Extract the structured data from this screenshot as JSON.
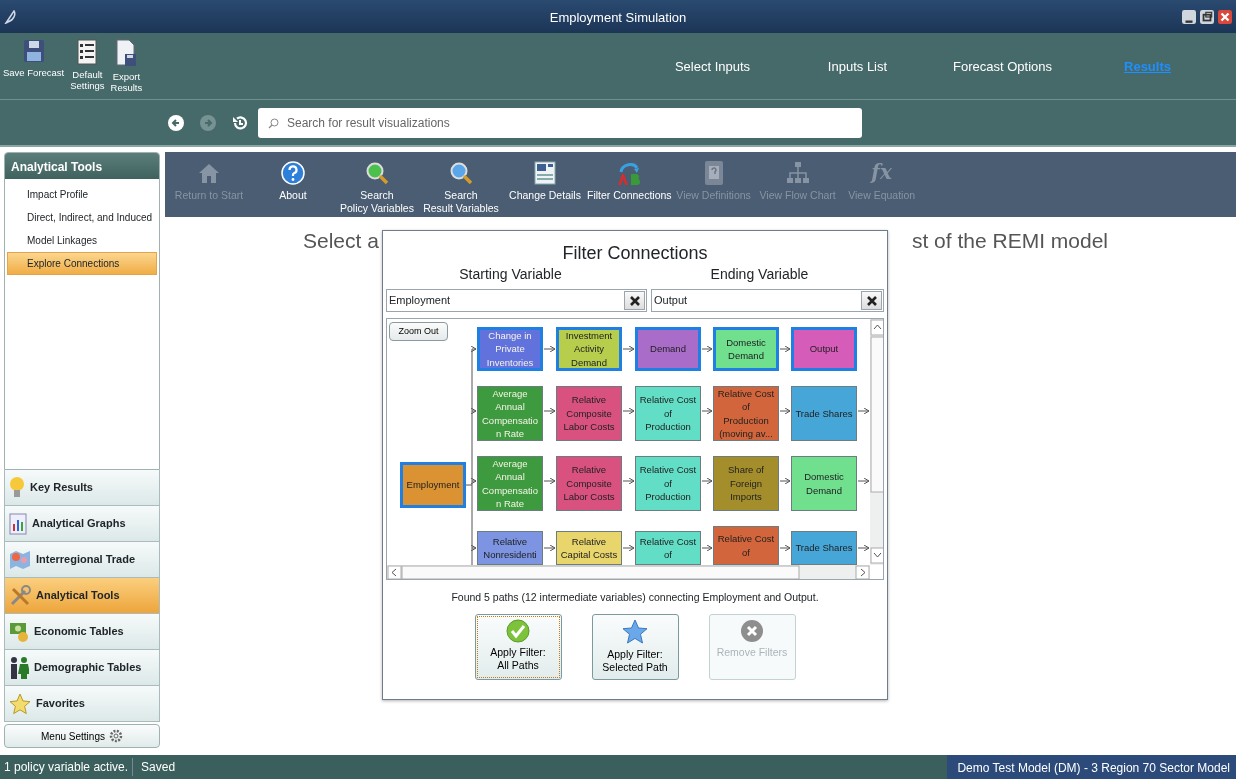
{
  "window": {
    "title": "Employment Simulation"
  },
  "ribbon": {
    "buttons": [
      "Save Forecast",
      "Default\nSettings",
      "Export\nResults"
    ],
    "nav": [
      {
        "label": "Select Inputs",
        "selected": false
      },
      {
        "label": "Inputs List",
        "selected": false
      },
      {
        "label": "Forecast Options",
        "selected": false
      },
      {
        "label": "Results",
        "selected": true
      }
    ]
  },
  "history": [
    {
      "disabled": false
    },
    {
      "disabled": true
    },
    {
      "disabled": false
    }
  ],
  "search": {
    "placeholder": "Search for result visualizations"
  },
  "sidebar": {
    "panel_title": "Analytical Tools",
    "items": [
      {
        "label": "Impact Profile",
        "selected": false
      },
      {
        "label": "Direct, Indirect, and Induced",
        "selected": false
      },
      {
        "label": "Model Linkages",
        "selected": false
      },
      {
        "label": "Explore Connections",
        "selected": true
      }
    ],
    "sections": [
      {
        "label": "Key Results",
        "selected": false
      },
      {
        "label": "Analytical Graphs",
        "selected": false
      },
      {
        "label": "Interregional Trade",
        "selected": false
      },
      {
        "label": "Analytical Tools",
        "selected": true
      },
      {
        "label": "Economic Tables",
        "selected": false
      },
      {
        "label": "Demographic Tables",
        "selected": false
      },
      {
        "label": "Favorites",
        "selected": false
      }
    ],
    "settings_button": "Menu Settings"
  },
  "toolbar": [
    {
      "label": "Return to Start",
      "disabled": true
    },
    {
      "label": "About",
      "disabled": false
    },
    {
      "label": "Search\nPolicy Variables",
      "disabled": false
    },
    {
      "label": "Search\nResult Variables",
      "disabled": false
    },
    {
      "label": "Change Details",
      "disabled": false
    },
    {
      "label": "Filter Connections",
      "disabled": false
    },
    {
      "label": "View Definitions",
      "disabled": true
    },
    {
      "label": "View Flow Chart",
      "disabled": true
    },
    {
      "label": "View Equation",
      "glyph": "fx",
      "disabled": true
    }
  ],
  "headline": {
    "before": "Select a",
    "after": "st of the REMI model"
  },
  "dialog": {
    "title": "Filter Connections",
    "start": {
      "label": "Starting Variable",
      "value": "Employment"
    },
    "end": {
      "label": "Ending Variable",
      "value": "Output"
    },
    "zoom_button": "Zoom Out",
    "source": {
      "text": "Employment",
      "color": "#db9232",
      "highlighted": true
    },
    "paths": [
      [
        {
          "text": "Change in\nPrivate\nInventories",
          "color": "#6272dc",
          "highlighted": true
        },
        {
          "text": "Investment\nActivity\nDemand",
          "color": "#b7cd4c",
          "highlighted": true
        },
        {
          "text": "Demand",
          "color": "#a96cc9",
          "highlighted": true
        },
        {
          "text": "Domestic\nDemand",
          "color": "#70e08f",
          "highlighted": true
        },
        {
          "text": "Output",
          "color": "#d65cb9",
          "highlighted": true
        }
      ],
      [
        {
          "text": "Average\nAnnual\nCompensatio\nn Rate",
          "color": "#3e9a3e",
          "highlighted": false
        },
        {
          "text": "Relative\nComposite\nLabor Costs",
          "color": "#d9527f",
          "highlighted": false
        },
        {
          "text": "Relative Cost\nof\nProduction",
          "color": "#62ddc6",
          "highlighted": false
        },
        {
          "text": "Relative Cost\nof\nProduction\n(moving av...",
          "color": "#d2653b",
          "highlighted": false
        },
        {
          "text": "Trade Shares",
          "color": "#46a6d8",
          "highlighted": false
        }
      ],
      [
        {
          "text": "Average\nAnnual\nCompensatio\nn Rate",
          "color": "#3e9a3e",
          "highlighted": false
        },
        {
          "text": "Relative\nComposite\nLabor Costs",
          "color": "#d9527f",
          "highlighted": false
        },
        {
          "text": "Relative Cost\nof\nProduction",
          "color": "#62ddc6",
          "highlighted": false
        },
        {
          "text": "Share of\nForeign\nImports",
          "color": "#a48e2c",
          "highlighted": false
        },
        {
          "text": "Domestic\nDemand",
          "color": "#70e08f",
          "highlighted": false
        }
      ],
      [
        {
          "text": "Relative\nNonresidenti",
          "color": "#7c94e1",
          "highlighted": false
        },
        {
          "text": "Relative\nCapital Costs",
          "color": "#e8d66c",
          "highlighted": false
        },
        {
          "text": "Relative Cost\nof",
          "color": "#62ddc6",
          "highlighted": false
        },
        {
          "text": "Relative Cost\nof",
          "color": "#d2653b",
          "highlighted": false
        },
        {
          "text": "Trade Shares",
          "color": "#46a6d8",
          "highlighted": false
        }
      ]
    ],
    "summary": "Found 5 paths (12 intermediate variables) connecting Employment and Output.",
    "buttons": [
      {
        "label": "Apply Filter:\nAll Paths",
        "disabled": false,
        "focused": true
      },
      {
        "label": "Apply Filter:\nSelected Path",
        "disabled": false,
        "focused": false
      },
      {
        "label": "Remove Filters",
        "disabled": true,
        "focused": false
      }
    ]
  },
  "status_bar": {
    "message": "1 policy variable active.",
    "state": "Saved",
    "model": "Demo Test Model (DM) -  3 Region 70 Sector Model"
  }
}
